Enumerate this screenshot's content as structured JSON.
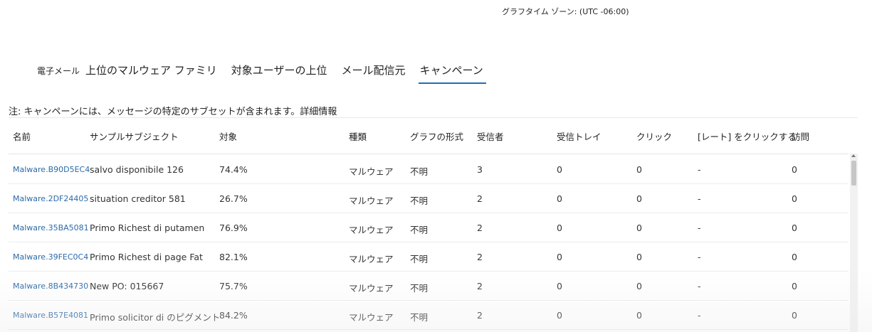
{
  "timezone": "グラフタイム ゾーン: (UTC -06:00)",
  "tabs": [
    {
      "label": "電子メール"
    },
    {
      "label": "上位のマルウェア ファミリ"
    },
    {
      "label": "対象ユーザーの上位"
    },
    {
      "label": "メール配信元"
    },
    {
      "label": "キャンペーン"
    }
  ],
  "note": {
    "text": "注: キャンペーンには、メッセージの特定のサブセットが含まれます。",
    "link": "詳細情報"
  },
  "columns": {
    "name": "名前",
    "subject": "サンプルサブジェクト",
    "target": "対象",
    "kind": "種類",
    "format": "グラフの形式",
    "recipients": "受信者",
    "inbox": "受信トレイ",
    "clicks": "クリック",
    "rate": "[レート] をクリックする",
    "visits": "訪問"
  },
  "rows": [
    {
      "name": "Malware.B90D5EC4",
      "subject": "salvo disponibile 126",
      "target": "74.4%",
      "kind": "マルウェア",
      "format": "不明",
      "recipients": "3",
      "inbox": "0",
      "clicks": "0",
      "rate": "-",
      "visits": "0"
    },
    {
      "name": "Malware.2DF24405",
      "subject": "situation creditor 581",
      "target": "26.7%",
      "kind": "マルウェア",
      "format": "不明",
      "recipients": "2",
      "inbox": "0",
      "clicks": "0",
      "rate": "-",
      "visits": "0"
    },
    {
      "name": "Malware.35BA5081",
      "subject": "Primo Richest di putamen",
      "target": "76.9%",
      "kind": "マルウェア",
      "format": "不明",
      "recipients": "2",
      "inbox": "0",
      "clicks": "0",
      "rate": "-",
      "visits": "0"
    },
    {
      "name": "Malware.39FEC0C4",
      "subject": "Primo Richest di page Fat",
      "target": "82.1%",
      "kind": "マルウェア",
      "format": "不明",
      "recipients": "2",
      "inbox": "0",
      "clicks": "0",
      "rate": "-",
      "visits": "0"
    },
    {
      "name": "Malware.8B434730",
      "subject": "New PO: 015667",
      "target": "75.7%",
      "kind": "マルウェア",
      "format": "不明",
      "recipients": "2",
      "inbox": "0",
      "clicks": "0",
      "rate": "-",
      "visits": "0"
    },
    {
      "name": "Malware.B57E4081",
      "subject": "Primo solicitor di のピグメント",
      "target": "84.2%",
      "kind": "マルウェア",
      "format": "不明",
      "recipients": "2",
      "inbox": "0",
      "clicks": "0",
      "rate": "-",
      "visits": "0"
    }
  ],
  "colors": {
    "accent": "#1f6fb5",
    "link": "#2b6aa8"
  }
}
